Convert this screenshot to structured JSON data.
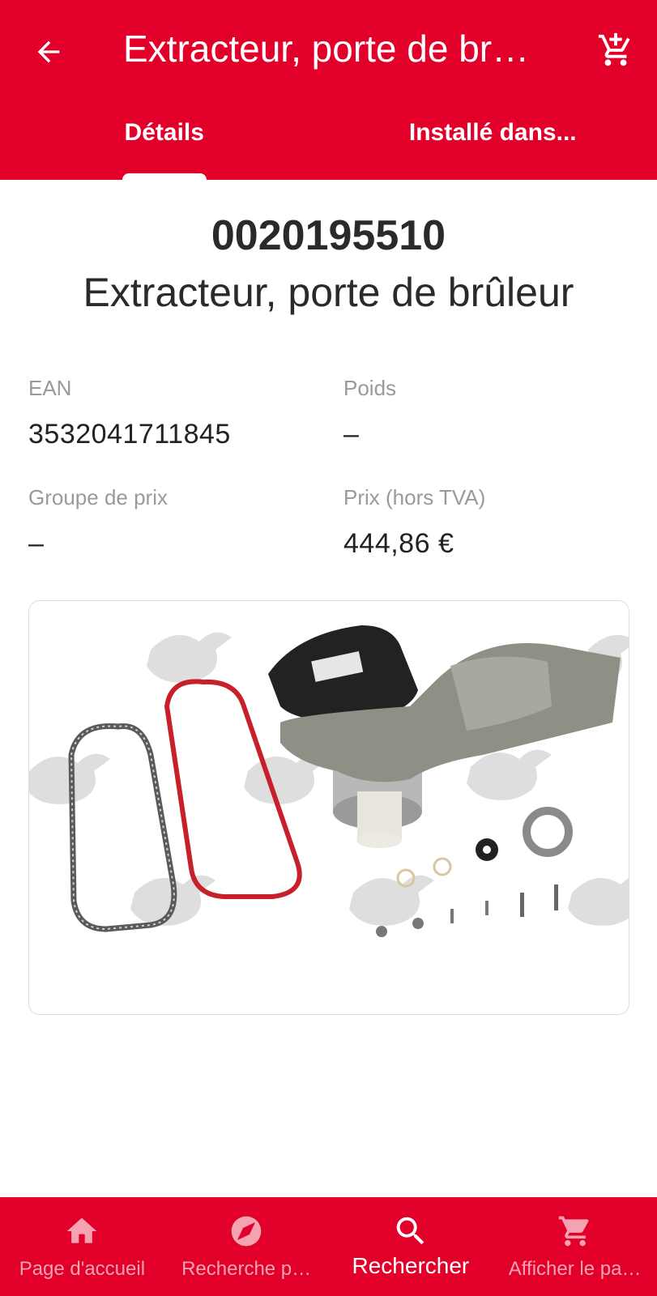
{
  "header": {
    "title": "Extracteur, porte de br…",
    "back_icon": "arrow-back-icon",
    "cart_icon": "add-shopping-cart-icon"
  },
  "tabs": [
    {
      "label": "Détails",
      "selected": true
    },
    {
      "label": "Installé dans...",
      "selected": false
    }
  ],
  "product": {
    "part_number": "0020195510",
    "name": "Extracteur, porte de brûleur"
  },
  "fields": {
    "ean": {
      "label": "EAN",
      "value": "3532041711845"
    },
    "poids": {
      "label": "Poids",
      "value": "–"
    },
    "groupe_prix": {
      "label": "Groupe de prix",
      "value": "–"
    },
    "prix": {
      "label": "Prix (hors TVA)",
      "value": "444,86 €"
    }
  },
  "bottom_nav": [
    {
      "label": "Page d'accueil",
      "icon": "home-icon",
      "active": false
    },
    {
      "label": "Recherche p…",
      "icon": "compass-icon",
      "active": false
    },
    {
      "label": "Rechercher",
      "icon": "search-icon",
      "active": true
    },
    {
      "label": "Afficher le pa…",
      "icon": "shopping-cart-icon",
      "active": false
    }
  ],
  "colors": {
    "brand_red": "#e2002a",
    "inactive_nav": "#f4a3b3",
    "label_grey": "#9a9a9a"
  }
}
